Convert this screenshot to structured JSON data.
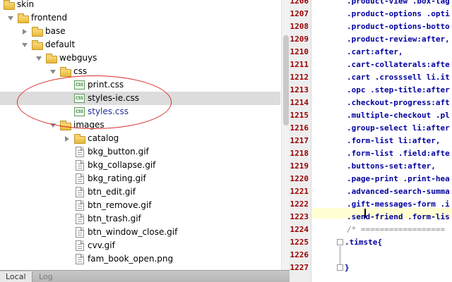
{
  "tree": {
    "rows": [
      {
        "label": "skin",
        "type": "folder",
        "expanded": true
      },
      {
        "label": "frontend",
        "type": "folder",
        "expanded": true
      },
      {
        "label": "base",
        "type": "folder",
        "expanded": false
      },
      {
        "label": "default",
        "type": "folder",
        "expanded": true
      },
      {
        "label": "webguys",
        "type": "folder",
        "expanded": true
      },
      {
        "label": "css",
        "type": "folder",
        "expanded": true
      },
      {
        "label": "print.css",
        "type": "css"
      },
      {
        "label": "styles-ie.css",
        "type": "css",
        "selected": true
      },
      {
        "label": "styles.css",
        "type": "css",
        "link": true
      },
      {
        "label": "images",
        "type": "folder",
        "expanded": true
      },
      {
        "label": "catalog",
        "type": "folder",
        "expanded": false
      },
      {
        "label": "bkg_button.gif",
        "type": "file"
      },
      {
        "label": "bkg_collapse.gif",
        "type": "file"
      },
      {
        "label": "bkg_rating.gif",
        "type": "file"
      },
      {
        "label": "btn_edit.gif",
        "type": "file"
      },
      {
        "label": "btn_remove.gif",
        "type": "file"
      },
      {
        "label": "btn_trash.gif",
        "type": "file"
      },
      {
        "label": "btn_window_close.gif",
        "type": "file"
      },
      {
        "label": "cvv.gif",
        "type": "file"
      },
      {
        "label": "fam_book_open.png",
        "type": "file"
      }
    ]
  },
  "tabs": [
    {
      "label": "Local",
      "active": true
    },
    {
      "label": "Log",
      "active": false
    }
  ],
  "editor": {
    "lines": [
      {
        "n": "1206",
        "code": ".product-view .box-tag"
      },
      {
        "n": "1207",
        "code": ".product-options .opti"
      },
      {
        "n": "1208",
        "code": ".product-options-botto"
      },
      {
        "n": "1209",
        "code": ".product-review:after,"
      },
      {
        "n": "1210",
        "code": ".cart:after,"
      },
      {
        "n": "1211",
        "code": ".cart-collaterals:afte"
      },
      {
        "n": "1212",
        "code": ".cart .crosssell li.it"
      },
      {
        "n": "1213",
        "code": ".opc .step-title:after"
      },
      {
        "n": "1214",
        "code": ".checkout-progress:aft"
      },
      {
        "n": "1215",
        "code": ".multiple-checkout .pl"
      },
      {
        "n": "1216",
        "code": ".group-select li:after"
      },
      {
        "n": "1217",
        "code": ".form-list li:after,"
      },
      {
        "n": "1218",
        "code": ".form-list .field:afte"
      },
      {
        "n": "1219",
        "code": ".buttons-set:after,"
      },
      {
        "n": "1220",
        "code": ".page-print .print-hea"
      },
      {
        "n": "1221",
        "code": ".advanced-search-summa"
      },
      {
        "n": "1222",
        "code": ".gift-messages-form .i"
      },
      {
        "n": "1223",
        "code": ".send-friend .form-lis"
      },
      {
        "n": "1224",
        "code": "/* ==================",
        "comment": true
      },
      {
        "n": "1225",
        "code": ".timste{",
        "indent0": true
      },
      {
        "n": "1226",
        "code": ""
      },
      {
        "n": "1227",
        "code": "}",
        "indent0": true
      }
    ]
  },
  "colors": {
    "annotation": "#d9302b",
    "selector": "#0000a0",
    "line_number": "#9a0000",
    "current_line": "#ffffd2"
  }
}
